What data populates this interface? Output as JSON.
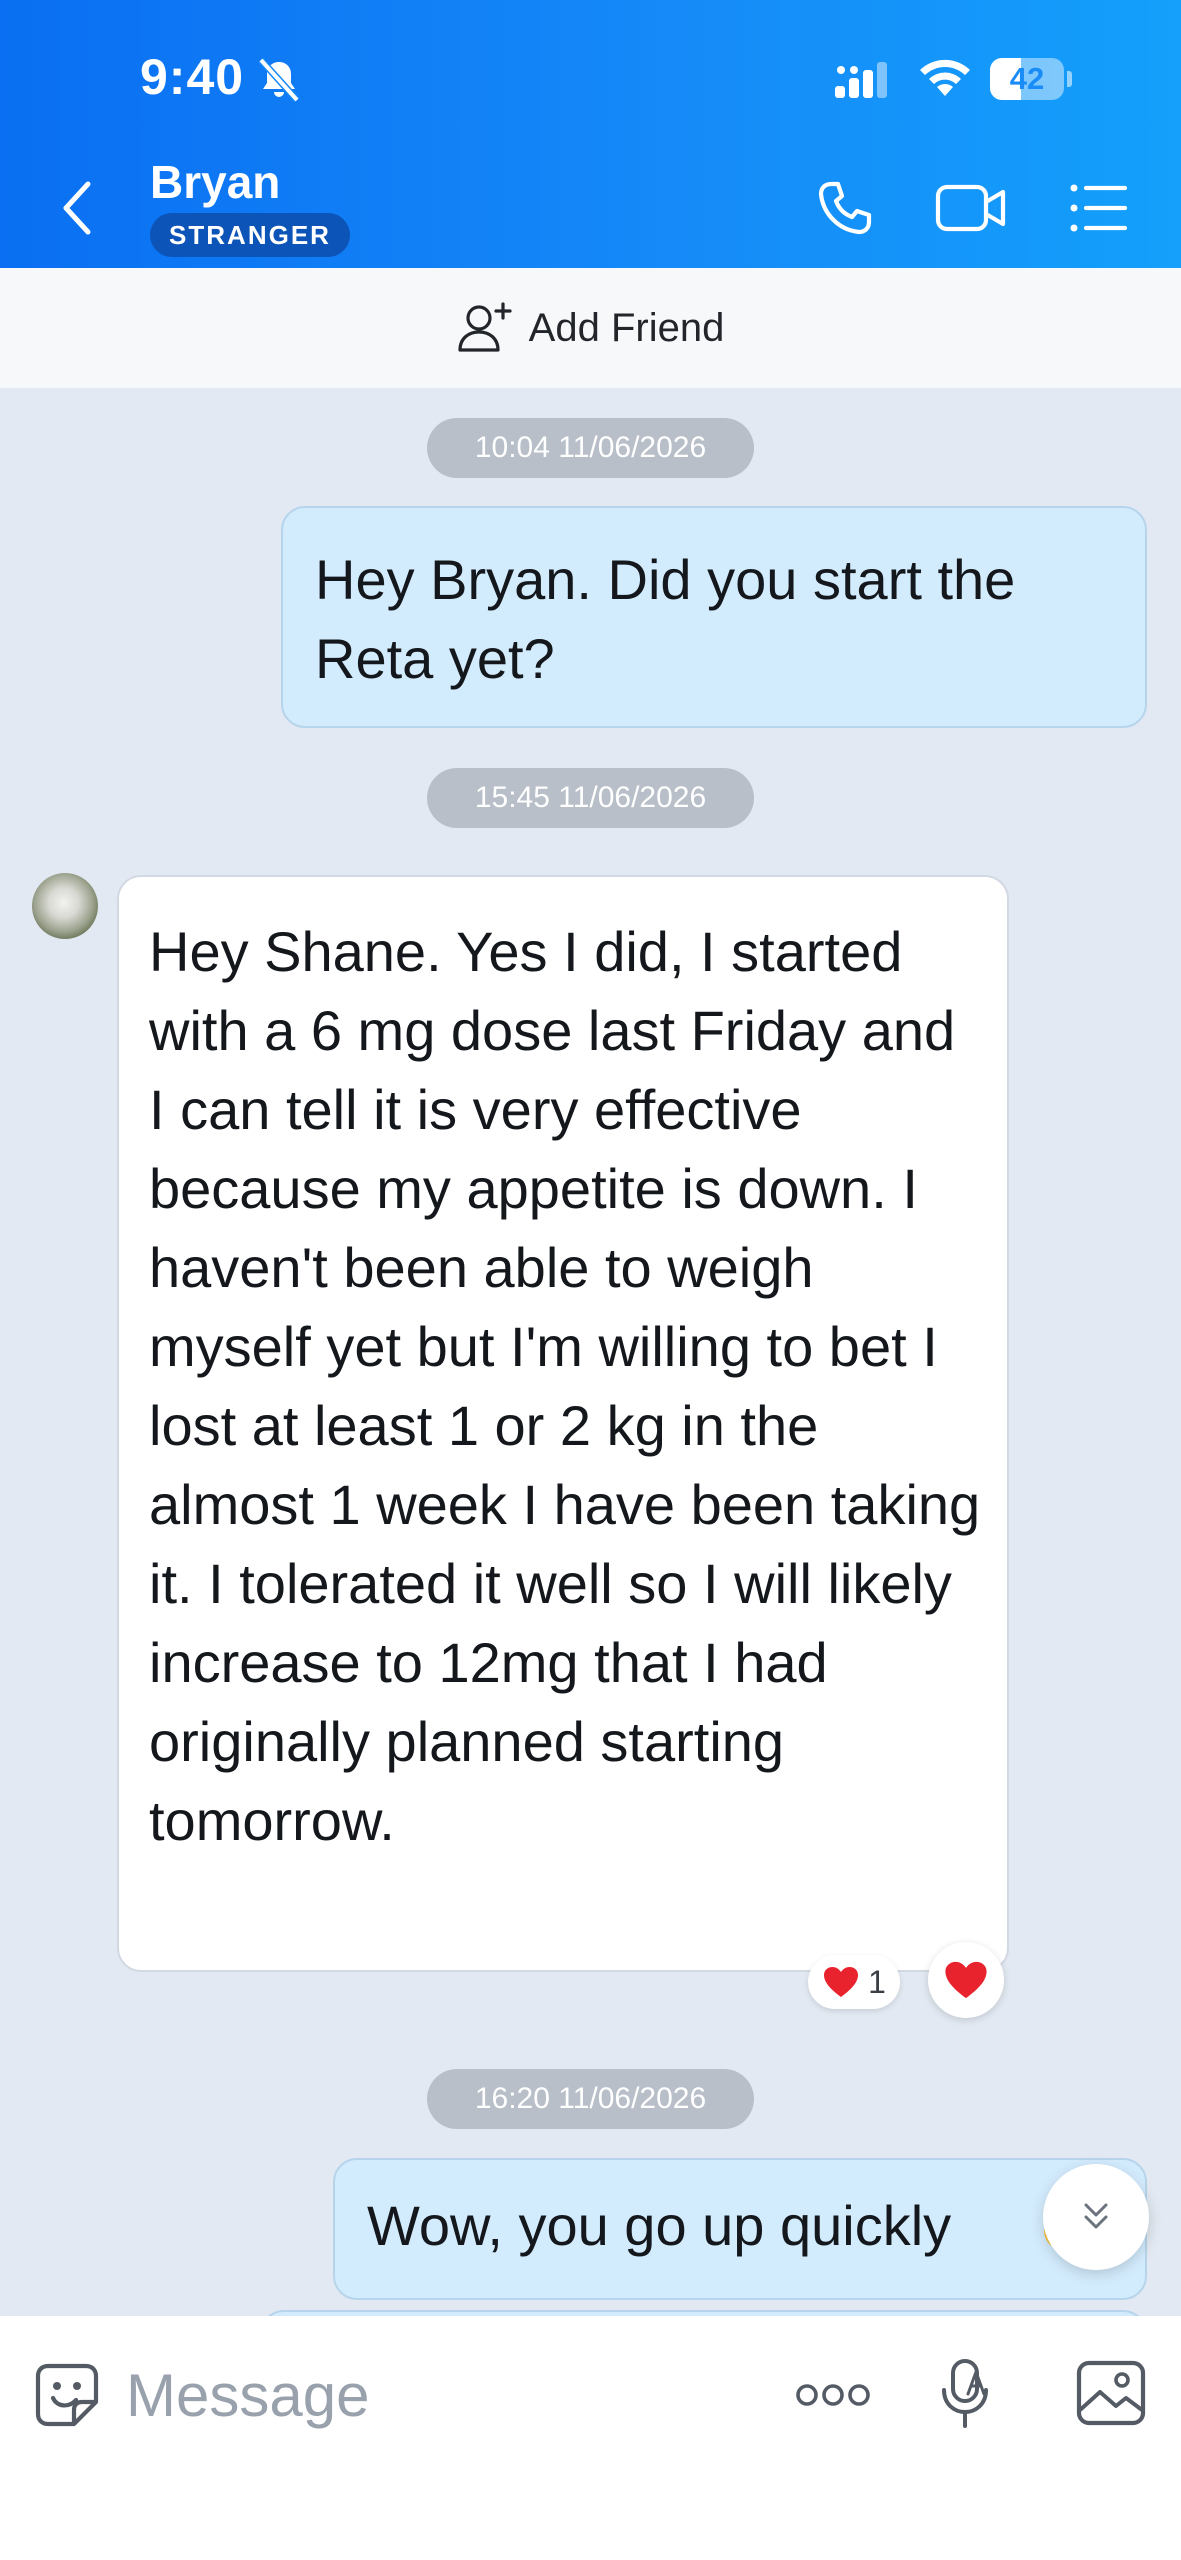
{
  "status_bar": {
    "time": "9:40",
    "battery_level": "42",
    "battery_fraction": 0.42
  },
  "header": {
    "contact_name": "Bryan",
    "badge": "STRANGER"
  },
  "add_friend": {
    "label": "Add Friend"
  },
  "messages": [
    {
      "timestamp": "10:04 11/06/2026",
      "direction": "outgoing",
      "text": "Hey Bryan. Did you start the Reta yet?"
    },
    {
      "timestamp": "15:45 11/06/2026",
      "direction": "incoming",
      "text": "Hey Shane. Yes I did, I started with a 6 mg dose last Friday and I can tell it is very effective because my appetite is down. I haven't been able to weigh myself yet but I'm willing to bet I lost at least 1 or 2 kg in the almost 1 week I have been taking it. I tolerated it well so I will likely increase to 12mg that I had originally planned starting tomorrow.",
      "reaction": {
        "emoji": "heart",
        "count": "1"
      }
    },
    {
      "timestamp": "16:20 11/06/2026",
      "direction": "outgoing",
      "text": "Wow, you go up quickly"
    }
  ],
  "composer": {
    "placeholder": "Message"
  },
  "icons": {
    "back": "chevron-left-icon",
    "call": "phone-icon",
    "video": "video-camera-icon",
    "menu": "list-menu-icon",
    "add_friend": "add-user-icon",
    "sticker": "sticker-icon",
    "more": "more-dots-icon",
    "voice": "voice-to-text-icon",
    "image": "image-icon",
    "scroll_down": "double-chevron-down-icon"
  },
  "colors": {
    "header_start": "#0a6ff2",
    "header_end": "#14a0fb",
    "outgoing_bubble": "#d3ecfd",
    "incoming_bubble": "#ffffff",
    "chat_background": "#e2e9f2",
    "timestamp_pill": "#b8bfc8",
    "badge": "#0c54b8",
    "heart": "#e8232e"
  }
}
